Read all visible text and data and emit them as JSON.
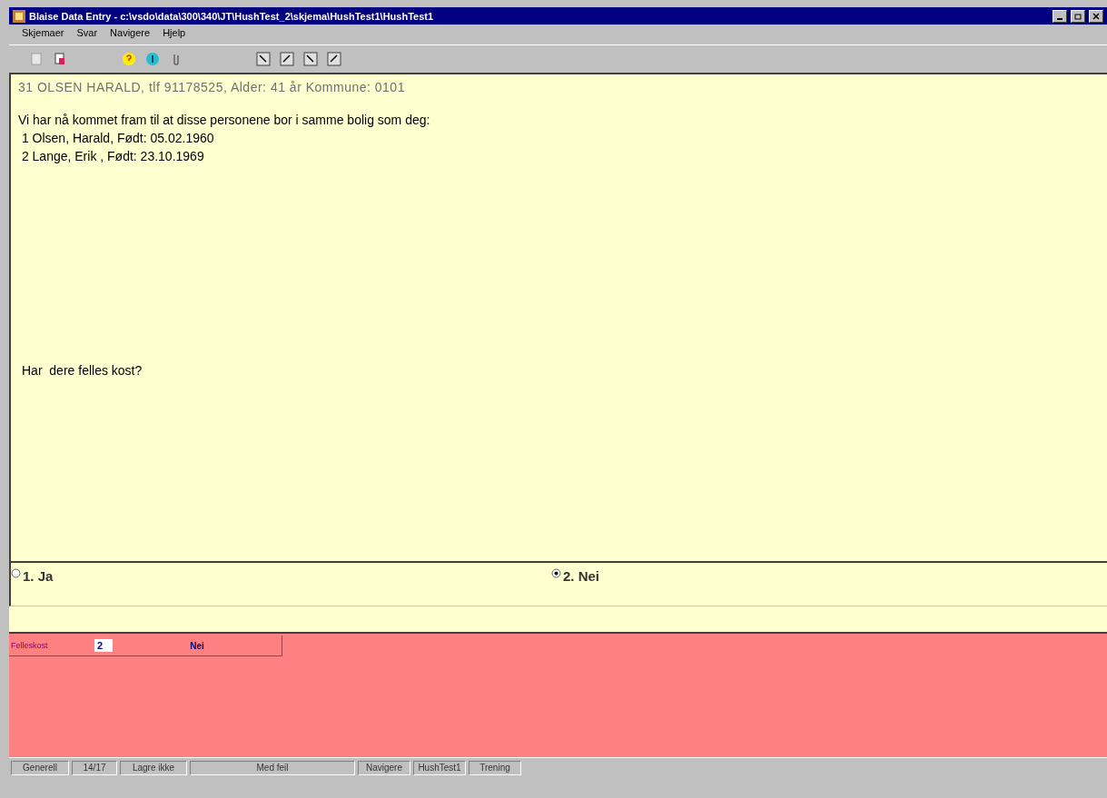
{
  "window": {
    "title": "Blaise Data Entry - c:\\vsdo\\data\\300\\340\\JT\\HushTest_2\\skjema\\HushTest1\\HushTest1"
  },
  "menu": [
    "Skjemaer",
    "Svar",
    "Navigere",
    "Hjelp"
  ],
  "question": {
    "header": "31 OLSEN HARALD,  tlf 91178525, Alder:  41 år Kommune: 0101",
    "intro": "Vi har nå kommet fram til at disse personene bor i samme bolig som deg:",
    "lines": [
      " 1 Olsen, Harald, Født: 05.02.1960",
      " 2 Lange, Erik , Født: 23.10.1969"
    ],
    "prompt": "Har  dere felles kost?"
  },
  "options": [
    {
      "label": "1. Ja",
      "selected": false
    },
    {
      "label": "2. Nei",
      "selected": true
    }
  ],
  "field": {
    "name": "Felleskost",
    "value": "2",
    "answer": "Nei"
  },
  "status_bar": [
    "Generell",
    "14/17",
    "Lagre ikke",
    "Med feil",
    "Navigere",
    "HushTest1",
    "Trening"
  ]
}
